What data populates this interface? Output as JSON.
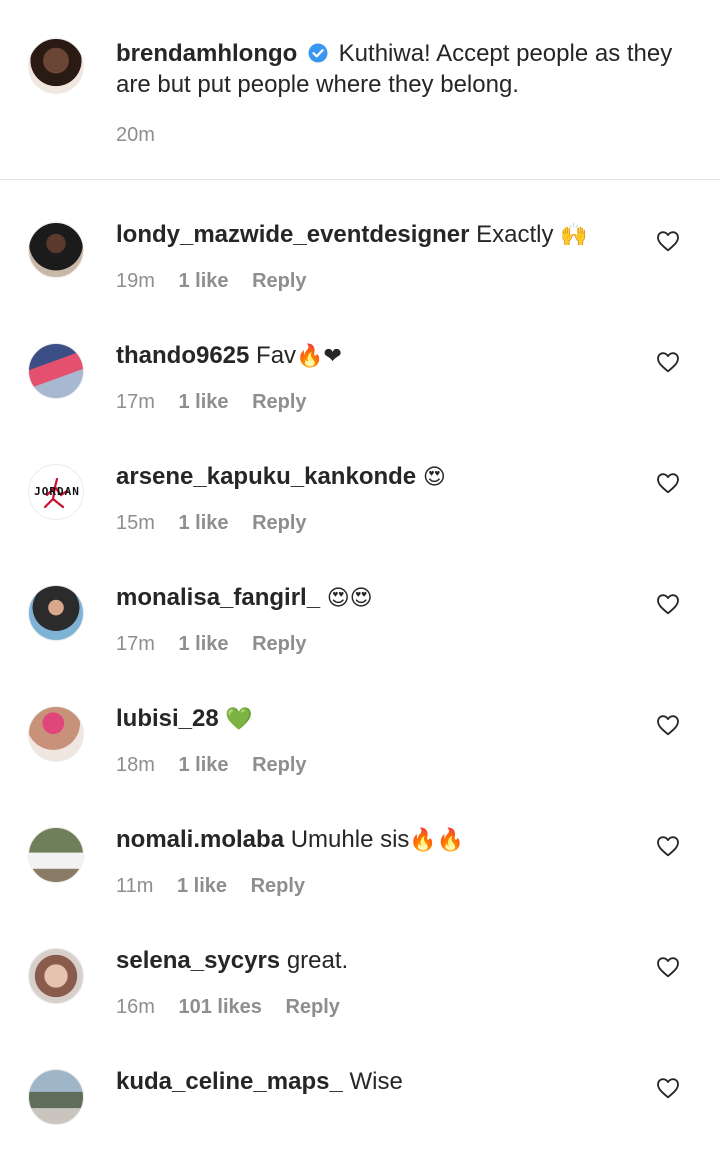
{
  "caption": {
    "username": "brendamhlongo",
    "text": "Kuthiwa! Accept people as they are but put people where they belong.",
    "time": "20m"
  },
  "colors": {
    "verified": "#3897f0",
    "meta": "#8e8e8e",
    "text": "#262626"
  },
  "comments": [
    {
      "username": "londy_mazwide_eventdesigner",
      "text": "Exactly",
      "emoji": "🙌",
      "time": "19m",
      "likes": "1 like",
      "reply": "Reply"
    },
    {
      "username": "thando9625",
      "text": "Fav",
      "emoji": "🔥❤",
      "time": "17m",
      "likes": "1 like",
      "reply": "Reply"
    },
    {
      "username": "arsene_kapuku_kankonde",
      "text": "",
      "emoji": "😍",
      "time": "15m",
      "likes": "1 like",
      "reply": "Reply",
      "avatar_text": "JORDAN"
    },
    {
      "username": "monalisa_fangirl_",
      "text": "",
      "emoji": "😍😍",
      "time": "17m",
      "likes": "1 like",
      "reply": "Reply"
    },
    {
      "username": "lubisi_28",
      "text": "",
      "emoji": "💚",
      "time": "18m",
      "likes": "1 like",
      "reply": "Reply"
    },
    {
      "username": "nomali.molaba",
      "text": "Umuhle sis",
      "emoji": "🔥🔥",
      "time": "11m",
      "likes": "1 like",
      "reply": "Reply"
    },
    {
      "username": "selena_sycyrs",
      "text": "great.",
      "emoji": "",
      "time": "16m",
      "likes": "101 likes",
      "reply": "Reply"
    },
    {
      "username": "kuda_celine_maps_",
      "text": "Wise",
      "emoji": "",
      "time": "",
      "likes": "",
      "reply": ""
    }
  ]
}
